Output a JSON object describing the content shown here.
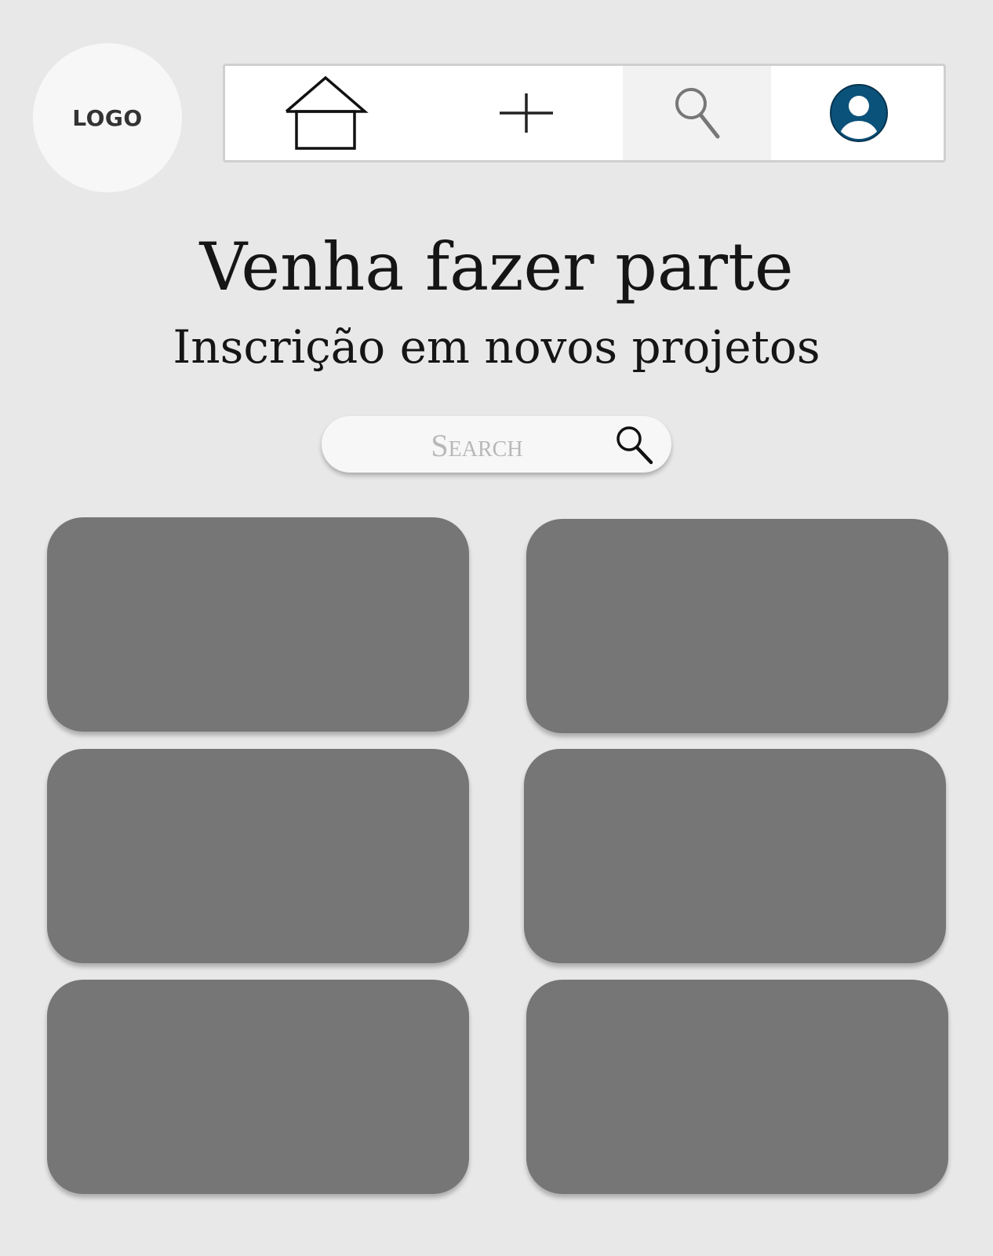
{
  "logo": {
    "label": "LOGO"
  },
  "navbar": {
    "items": [
      {
        "name": "home",
        "icon": "home-icon"
      },
      {
        "name": "add",
        "icon": "plus-icon"
      },
      {
        "name": "search",
        "icon": "search-icon"
      },
      {
        "name": "profile",
        "icon": "user-avatar-icon"
      }
    ],
    "avatar_color": "#0b527a"
  },
  "hero": {
    "title": "Venha fazer parte",
    "subtitle": "Inscrição em novos projetos"
  },
  "search": {
    "placeholder": "Search",
    "value": ""
  },
  "cards": {
    "count": 6,
    "color": "#767676"
  }
}
